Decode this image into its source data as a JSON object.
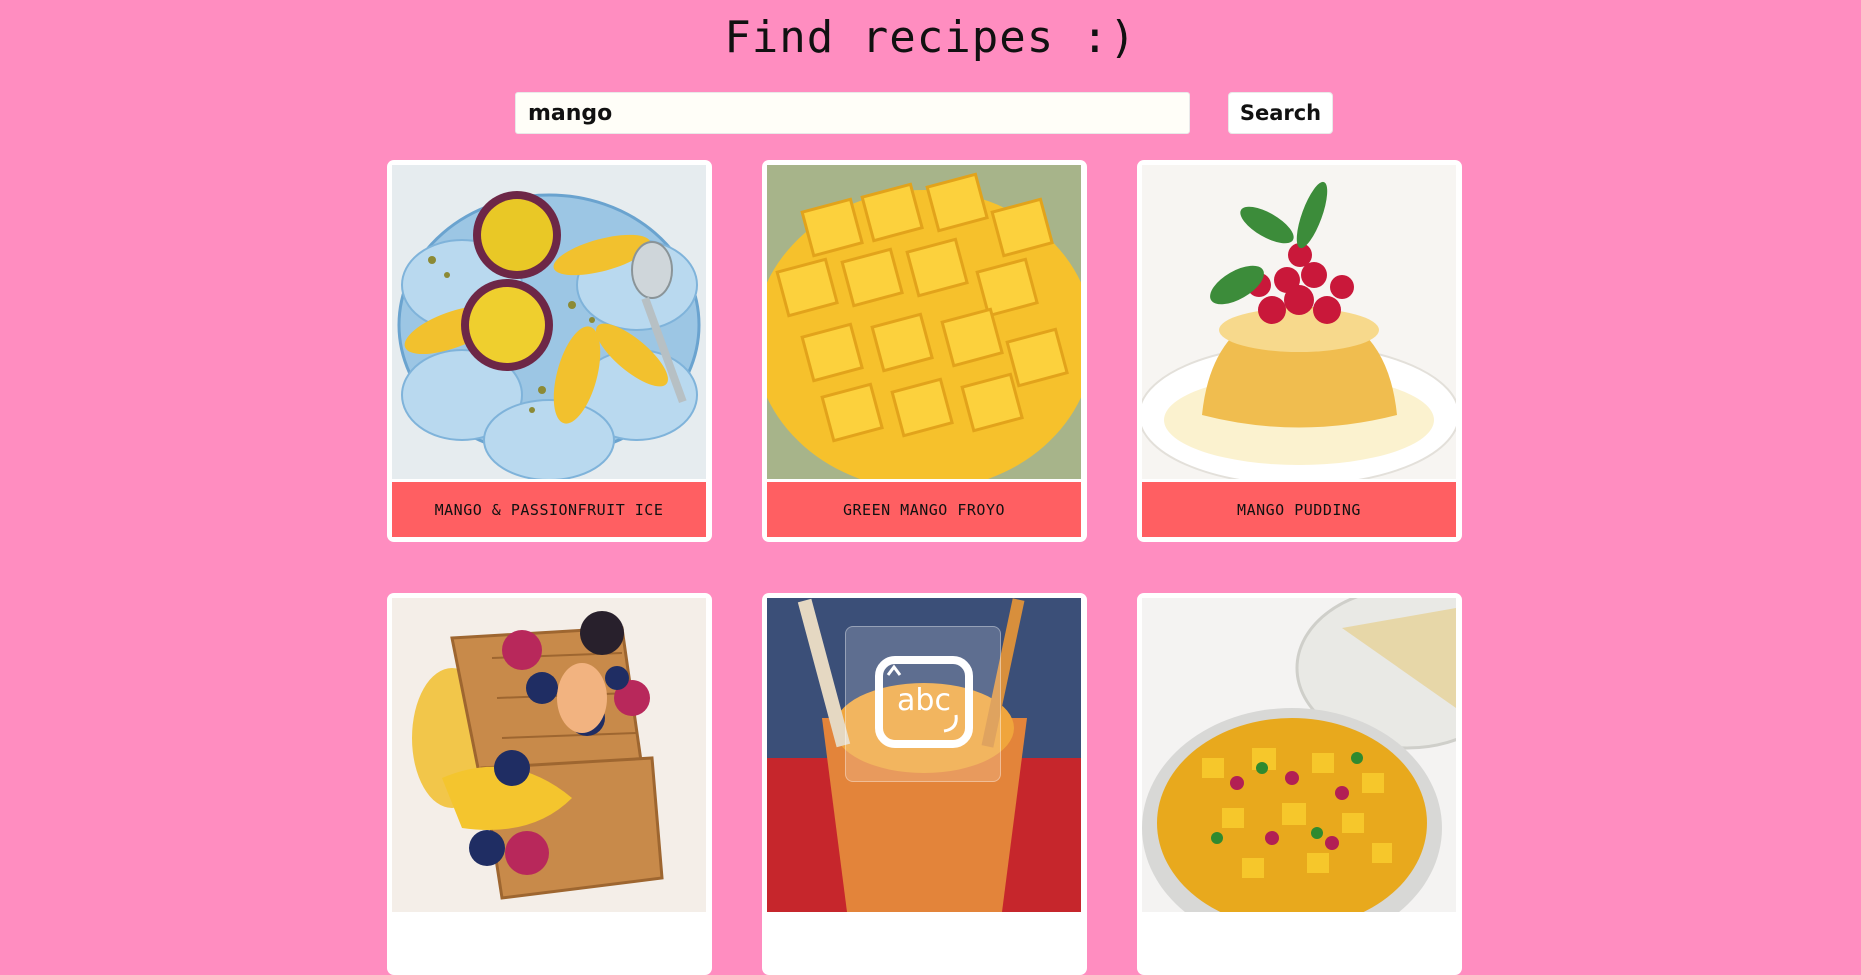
{
  "header": {
    "title": "Find recipes :)"
  },
  "search": {
    "value": "mango",
    "button_label": "Search"
  },
  "recipes": [
    {
      "label": "MANGO & PASSIONFRUIT ICE"
    },
    {
      "label": "GREEN MANGO FROYO"
    },
    {
      "label": "MANGO PUDDING"
    },
    {
      "label": ""
    },
    {
      "label": ""
    },
    {
      "label": ""
    }
  ],
  "overlay": {
    "icon": "text-recognition-icon",
    "text": "abc"
  },
  "colors": {
    "background": "#ff8dc0",
    "label": "#ff5f62",
    "card": "#ffffff"
  }
}
